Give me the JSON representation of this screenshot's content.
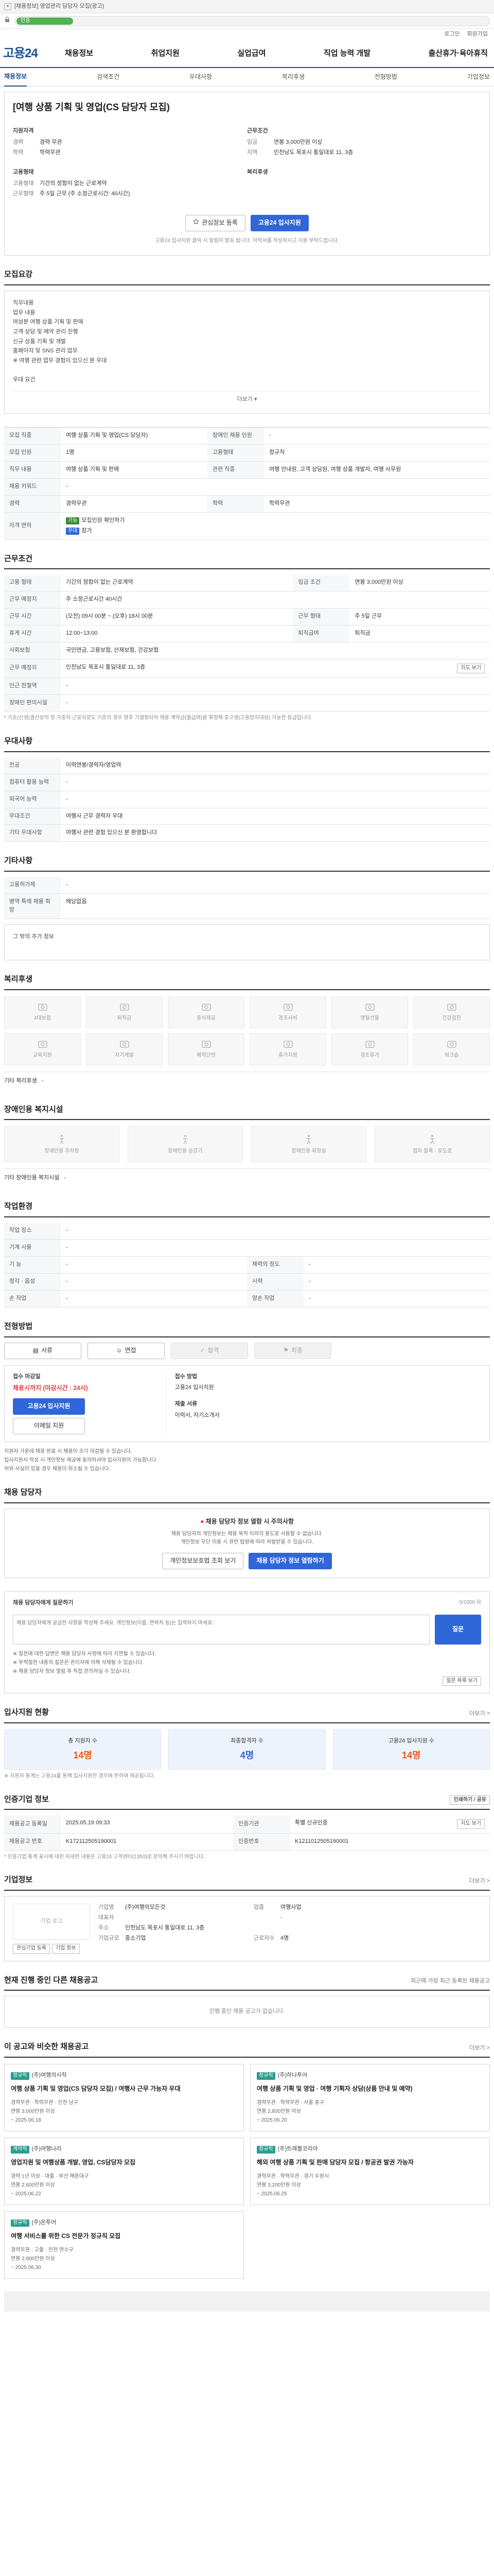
{
  "browser": {
    "notice": "[채용정보] 영업관리 담당자 모집(광고)",
    "progress_label": "인증"
  },
  "utility": [
    "로그인",
    "회원가입"
  ],
  "header": {
    "logo": "고용24",
    "menu": [
      "채용정보",
      "취업지원",
      "실업급여",
      "직업 능력 개발",
      "출산휴가·육아휴직"
    ]
  },
  "tabs": [
    "채용정보",
    "검색조건",
    "우대사항",
    "복리후생",
    "전형방법",
    "기업정보"
  ],
  "job": {
    "title": "[여행 상품 기획 및 영업(CS 담당자 모집)",
    "company_label": "지원자격",
    "company": [
      {
        "k": "경력",
        "v": "경력 무관"
      },
      {
        "k": "학력",
        "v": "학력무관"
      }
    ],
    "cond_label": "고용형태",
    "cond": [
      {
        "k": "고용형태",
        "v": "기간의 정함이 없는 근로계약"
      },
      {
        "k": "근무형태",
        "v": "주 5일 근무 (주 소정근로시간: 40시간)"
      }
    ],
    "pay_label": "근무조건",
    "pay": [
      {
        "k": "임금",
        "v": "연봉 3,000만원 이상"
      },
      {
        "k": "지역",
        "v": "인천남도 목포시 통일대로 11, 3층"
      }
    ],
    "welfare_label": "복리후생",
    "btn_scrap": "관심정보 등록",
    "btn_apply": "고용24 입사지원",
    "note": "고용24 입사지원 클릭 시 알림이 발송 됩니다. 이력서를 작성하시고 지원 부탁드립니다."
  },
  "duty": {
    "title": "모집요강",
    "text": "직무내용\n업무 내용\n여성분 여행 상품 기획 및 판매\n고객 상담 및 예약 관리 진행\n신규 상품 기획 및 개발\n홈페이지 및 SNS 관리 업무\n※ 여행 관련 업무 경험이 있으신 분 우대\n\n우대 요건",
    "fold": "더보기 ▾"
  },
  "recruit": {
    "rows": [
      [
        "모집 직종",
        "여행 상품 기획 및 영업(CS 담당자)",
        "장애인 채용 인원",
        "-"
      ],
      [
        "모집 인원",
        "1명",
        "고용형태",
        "정규직"
      ],
      [
        "직무 내용",
        "여행 상품 기획 및 판매",
        "관련 직종",
        "여행 안내원, 고객 상담원, 여행 상품 개발자, 여행 사무원"
      ],
      [
        "채용 키워드",
        "-",
        "",
        ""
      ],
      [
        "경력",
        "경력무관",
        "학력",
        "학력무관"
      ],
      [
        "자격 면허",
        "-",
        "",
        ""
      ]
    ],
    "tags": [
      "가능",
      "모집인원 확인하기",
      "우대",
      "참가"
    ]
  },
  "cond": {
    "title": "근무조건",
    "rows": [
      [
        "고용 형태",
        "기간의 정함이 없는 근로계약",
        "임금 조건",
        "연봉 3,000만원 이상"
      ],
      [
        "근무 예정지",
        "주 소정근로시간 40시간",
        "",
        ""
      ],
      [
        "근무 시간",
        "(오전) 09시 00분 ~ (오후) 18시 00분",
        "근무 형태",
        "주 5일 근무"
      ],
      [
        "휴게 시간",
        "12:00~13:00",
        "퇴직급여",
        "퇴직금"
      ],
      [
        "사회보험",
        "국민연금, 고용보험, 산재보험, 건강보험",
        "",
        ""
      ],
      [
        "근무 예정지",
        "인천남도 목포시 통일대로 11, 3층",
        "",
        ""
      ],
      [
        "인근 전철역",
        "-",
        "",
        ""
      ],
      [
        "장애인 편의시설",
        "-",
        "",
        ""
      ]
    ],
    "map_btn": "지도 보기",
    "note": "* 기초(신생)결산상의 장 가중치 근로자로도 기준의 경우 향후 기결정되어 채용 계약금(월급여)을 확정해 중고생(고용방지대상) 가능한 등급입니다."
  },
  "pref": {
    "title": "우대사항",
    "rows": [
      [
        "전공",
        "이력연봉/경력자/영업력"
      ],
      [
        "컴퓨터 활용 능력",
        "-"
      ],
      [
        "외국어 능력",
        "-"
      ],
      [
        "우대조건",
        "여행사 근무 경력자 우대"
      ],
      [
        "기타 우대사항",
        "여행사 관련 경험 있으신 분 환영합니다"
      ]
    ]
  },
  "etc": {
    "title": "기타사항",
    "rows": [
      [
        "고용허가제",
        "-"
      ],
      [
        "병역 특례 채용 희망",
        "해당없음"
      ]
    ],
    "extra": "그 밖의 추가 정보"
  },
  "welfare": {
    "title": "복리후생",
    "items": [
      "4대보험",
      "퇴직금",
      "중식제공",
      "경조사비",
      "명절선물",
      "건강검진",
      "교육지원",
      "자기계발",
      "체력단련",
      "휴가지원",
      "경조휴가",
      "워크숍"
    ],
    "etc_label": "기타 복리후생",
    "etc_value": "-"
  },
  "disabled": {
    "title": "장애인용 복지시설",
    "items": [
      "장애인용 주차장",
      "장애인용 승강기",
      "장애인용 화장실",
      "점자 블록 · 유도로"
    ],
    "etc_label": "기타 장애인용 복지시설",
    "etc_value": "-"
  },
  "env": {
    "title": "작업환경",
    "rows": [
      [
        "작업 장소",
        "-",
        "",
        ""
      ],
      [
        "기계 사용",
        "-",
        "",
        ""
      ],
      [
        "기 능",
        "-",
        "체력의 정도",
        "-"
      ],
      [
        "청각 · 음성",
        "-",
        "시력",
        "-"
      ],
      [
        "손 작업",
        "-",
        "양손 작업",
        "-"
      ]
    ]
  },
  "select": {
    "title": "전형방법",
    "steps": [
      "서류",
      "면접",
      "합격",
      "최종"
    ],
    "apply_left_title": "접수 마감일",
    "apply_deadline": "채용시까지 (마감시간 : 24시)",
    "apply_btn": "고용24 입사지원",
    "apply_btn2": "이메일 지원",
    "method_title": "접수 방법",
    "method": "고용24 입사지원",
    "docs_title": "제출 서류",
    "docs": "이력서, 자기소개서",
    "notes": [
      "지원자 가운데 채용 완료 시 채용이 조기 마감될 수 있습니다.",
      "입사지원서 작성 시 개인정보 제공에 동의하셔야 입사지원이 가능합니다.",
      "허위 사실이 있을 경우 채용이 취소될 수 있습니다."
    ]
  },
  "manager": {
    "title": "채용 담당자",
    "alert": "채용 담당자 정보 열람 시 주의사항",
    "desc": "채용 담당자의 개인정보는 채용 목적 이외의 용도로 사용할 수 없습니다.\n개인정보 무단 이용 시 관련 법령에 따라 처벌받을 수 있습니다.",
    "btn1": "개인정보보호법 조회 보기",
    "btn2": "채용 담당자 정보 열람하기"
  },
  "qa": {
    "title": "채용 담당자에게 질문하기",
    "count": "0/1000 자",
    "placeholder": "채용 담당자에게 궁금한 사항을 작성해 주세요. 개인정보(이름, 연락처 등)는 입력하지 마세요.",
    "btn": "질문",
    "notes": [
      "※ 질문에 대한 답변은 채용 담당자 사정에 따라 지연될 수 있습니다.",
      "※ 부적절한 내용의 질문은 관리자에 의해 삭제될 수 있습니다.",
      "※ 채용 담당자 정보 열람 후 직접 문의하실 수 있습니다."
    ],
    "list_btn": "질문 목록 보기"
  },
  "status": {
    "title": "입사지원 현황",
    "more": "더보기 >",
    "items": [
      {
        "l": "총 지원자 수",
        "n": "14명"
      },
      {
        "l": "최종합격자 수",
        "n": "4명"
      },
      {
        "l": "고용24 입사지원 수",
        "n": "14명"
      }
    ],
    "note": "※ 지원자 통계는 고용24를 통해 입사지원한 경우에 한하여 제공됩니다."
  },
  "info": {
    "title": "인증기업 정보",
    "print": "인쇄하기 / 공유",
    "rows": [
      [
        "채용공고 등록일",
        "2025.05.19 09:33",
        "인증기관",
        "특별 신규인증"
      ],
      [
        "채용공고 번호",
        "K172112505190001",
        "인증번호",
        "K1211012505190001"
      ]
    ],
    "more": "지도 보기",
    "note": "* 인증기업 통계 표시에 대한 자세한 내용은 고용24 고객센터(1350)로 문의해 주시기 바랍니다."
  },
  "company": {
    "title": "기업정보",
    "more": "더보기 >",
    "logo": "기업 로고",
    "rows": [
      [
        "기업명",
        "(주)여행의모든것",
        "업종",
        "여행사업"
      ],
      [
        "대표자",
        "",
        "",
        "-"
      ],
      [
        "주소",
        "인천남도 목포시 통일대로 11, 3층",
        "",
        ""
      ],
      [
        "기업규모",
        "중소기업",
        "근로자수",
        "4명"
      ]
    ],
    "btn1": "관심기업 등록",
    "btn2": "기업 정보"
  },
  "similar": {
    "title": "현재 진행 중인 다른 채용공고",
    "empty": "진행 중인 채용 공고가 없습니다.",
    "right": "최근에 가장 최근 등록된 채용공고"
  },
  "reco": {
    "title": "이 공고와 비슷한 채용공고",
    "more": "더보기 >",
    "cards": [
      {
        "badge": "정규직",
        "company": "(주)여행의시작",
        "title": "여행 상품 기획 및 영업(CS 담당자 모집) / 여행사 근무 가능자 우대",
        "meta": "경력무관 · 학력무관 · 인천 남구\n연봉 3,000만원 이상",
        "date": "~ 2025.06.18"
      },
      {
        "badge": "정규직",
        "company": "(주)하나투어",
        "title": "여행 상품 기획 및 영업 · 여행 기획자 상담(상품 안내 및 예약)",
        "meta": "경력무관 · 학력무관 · 서울 중구\n연봉 2,800만원 이상",
        "date": "~ 2025.06.20"
      },
      {
        "badge": "계약직",
        "company": "(주)여행나라",
        "title": "영업지원 및 여행상품 개발, 영업, CS담당자 모집",
        "meta": "경력 1년 이상 · 대졸 · 부산 해운대구\n연봉 2,600만원 이상",
        "date": "~ 2025.06.22"
      },
      {
        "badge": "정규직",
        "company": "(주)트래블코리아",
        "title": "해외 여행 상품 기획 및 판매 담당자 모집 / 항공권 발권 가능자",
        "meta": "경력무관 · 학력무관 · 경기 수원시\n연봉 3,200만원 이상",
        "date": "~ 2025.06.25"
      },
      {
        "badge": "정규직",
        "company": "(주)온투어",
        "title": "여행 서비스를 위한 CS 전문가 정규직 모집",
        "meta": "경력무관 · 고졸 · 인천 연수구\n연봉 2,900만원 이상",
        "date": "~ 2025.06.30"
      }
    ]
  }
}
